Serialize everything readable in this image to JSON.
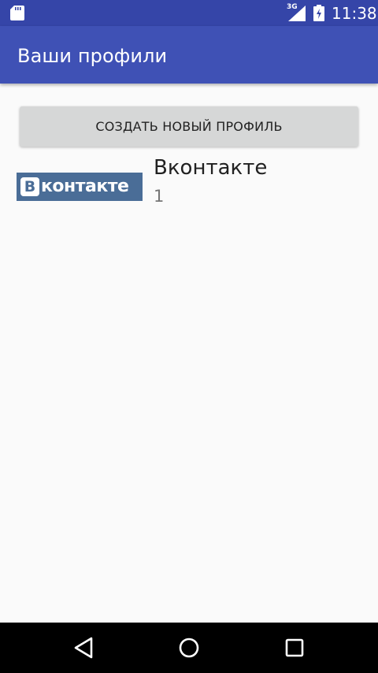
{
  "status_bar": {
    "network_type": "3G",
    "time": "11:38",
    "icons": [
      "sd-card-icon",
      "signal-icon",
      "battery-charging-icon"
    ]
  },
  "app_bar": {
    "title": "Ваши профили"
  },
  "main": {
    "create_button_label": "СОЗДАТЬ НОВЫЙ ПРОФИЛЬ",
    "profiles": [
      {
        "logo_letter": "В",
        "logo_text": "контакте",
        "name": "Вконтакте",
        "count": "1"
      }
    ]
  },
  "nav_bar": {
    "icons": [
      "back-icon",
      "home-icon",
      "recents-icon"
    ]
  },
  "colors": {
    "status_bar": "#3545a8",
    "app_bar": "#3f51b5",
    "background": "#fafafa",
    "button": "#d6d7d7",
    "vk_brand": "#4a6d97",
    "nav_bar": "#000000"
  }
}
